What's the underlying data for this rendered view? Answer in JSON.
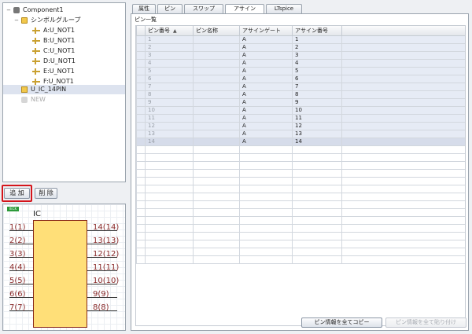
{
  "tree": {
    "component": "Component1",
    "group": "シンボルグループ",
    "pins": [
      "A:U_NOT1",
      "B:U_NOT1",
      "C:U_NOT1",
      "D:U_NOT1",
      "E:U_NOT1",
      "F:U_NOT1"
    ],
    "ic": "U_IC_14PIN",
    "new_item": "NEW"
  },
  "buttons": {
    "add": "追 加",
    "delete": "削 除"
  },
  "preview": {
    "badge": "IECK",
    "name": "IC",
    "left_pins": [
      "1(1)",
      "2(2)",
      "3(3)",
      "4(4)",
      "5(5)",
      "6(6)",
      "7(7)"
    ],
    "right_pins": [
      "14(14)",
      "13(13)",
      "12(12)",
      "11(11)",
      "10(10)",
      "9(9)",
      "8(8)"
    ]
  },
  "tabs": [
    "属性",
    "ピン",
    "スワップ",
    "アサイン",
    "LTspice"
  ],
  "active_tab": "アサイン",
  "pin_list": {
    "title": "ピン一覧",
    "columns": [
      "ピン番号",
      "ピン名称",
      "アサインゲート",
      "アサイン番号"
    ],
    "rows": [
      [
        "1",
        "",
        "A",
        "1"
      ],
      [
        "2",
        "",
        "A",
        "2"
      ],
      [
        "3",
        "",
        "A",
        "3"
      ],
      [
        "4",
        "",
        "A",
        "4"
      ],
      [
        "5",
        "",
        "A",
        "5"
      ],
      [
        "6",
        "",
        "A",
        "6"
      ],
      [
        "7",
        "",
        "A",
        "7"
      ],
      [
        "8",
        "",
        "A",
        "8"
      ],
      [
        "9",
        "",
        "A",
        "9"
      ],
      [
        "10",
        "",
        "A",
        "10"
      ],
      [
        "11",
        "",
        "A",
        "11"
      ],
      [
        "12",
        "",
        "A",
        "12"
      ],
      [
        "13",
        "",
        "A",
        "13"
      ],
      [
        "14",
        "",
        "A",
        "14"
      ]
    ]
  },
  "footer": {
    "copy_all": "ピン情報を全てコピー",
    "paste_all": "ピン情報を全て貼り付け"
  }
}
